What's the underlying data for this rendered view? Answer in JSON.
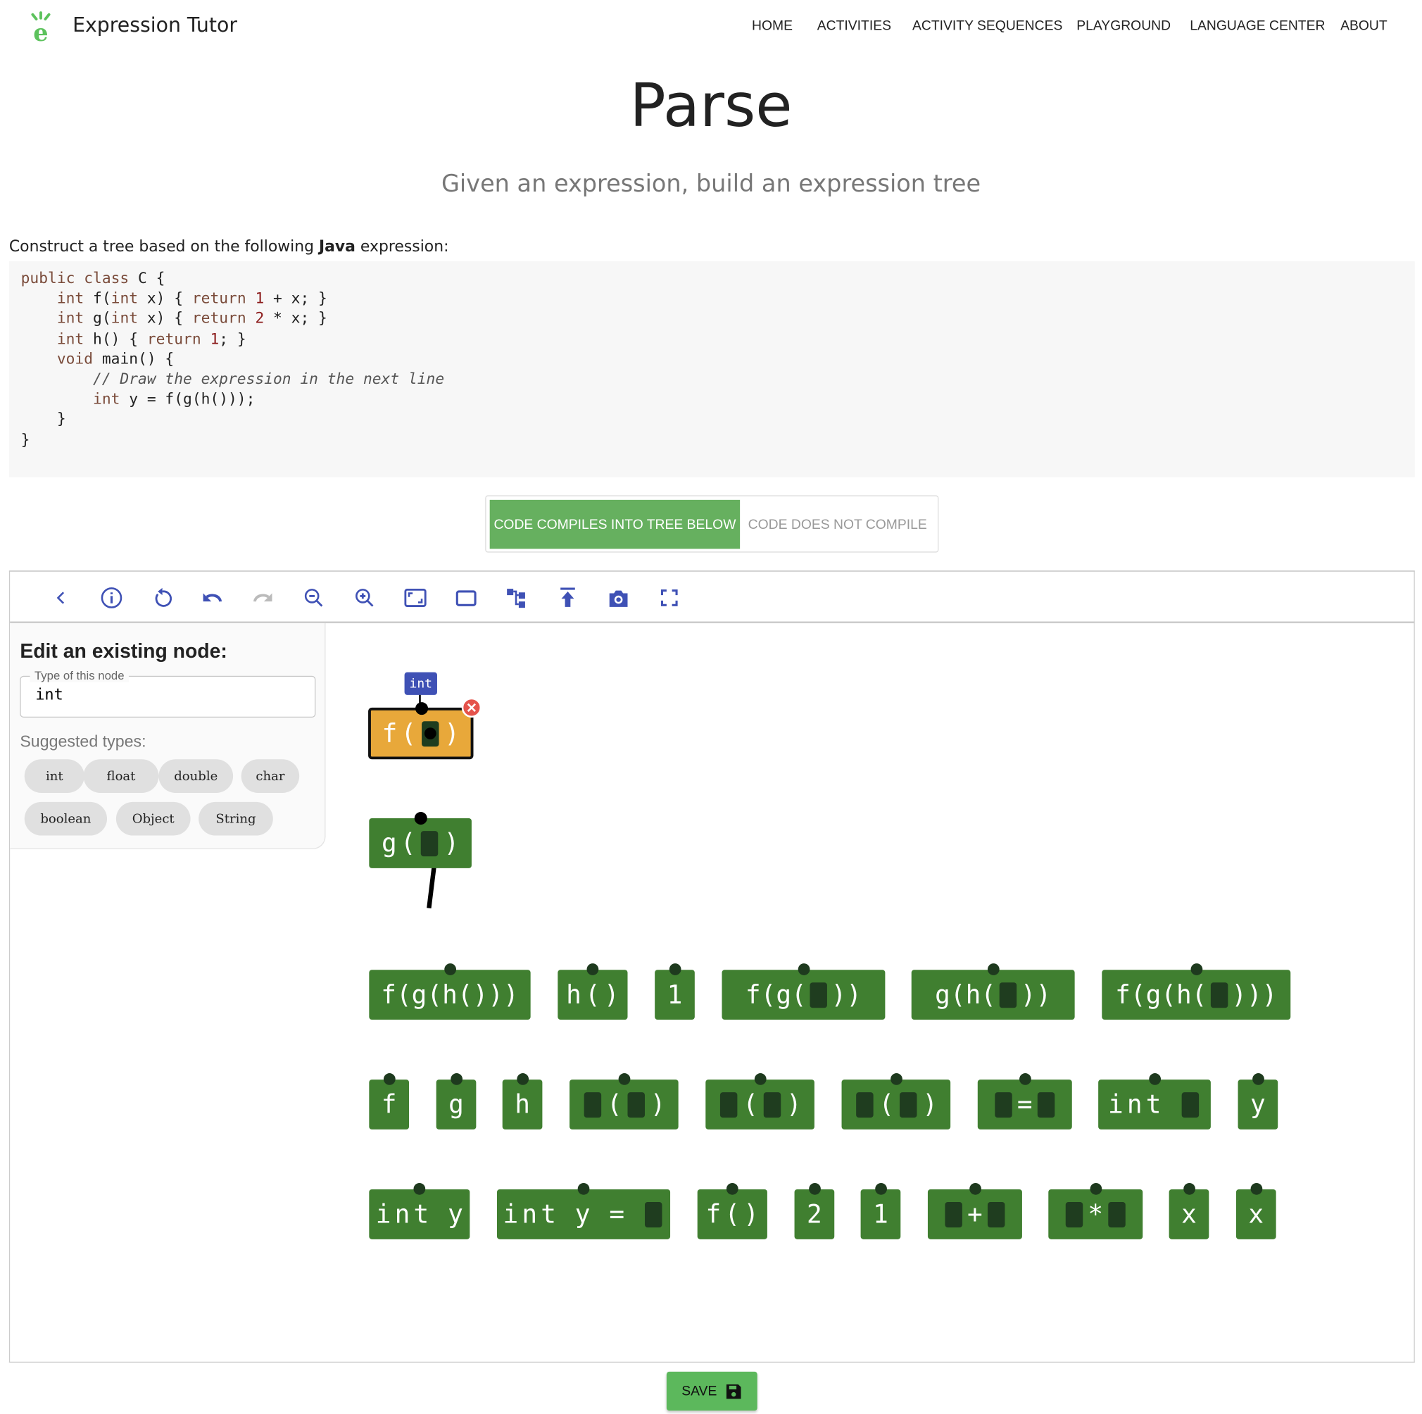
{
  "header": {
    "app_title": "Expression Tutor",
    "nav": [
      "HOME",
      "ACTIVITIES",
      "ACTIVITY SEQUENCES",
      "PLAYGROUND",
      "LANGUAGE CENTER",
      "ABOUT"
    ]
  },
  "page": {
    "title": "Parse",
    "subtitle": "Given an expression, build an expression tree",
    "instruction_prefix": "Construct a tree based on the following ",
    "instruction_lang": "Java",
    "instruction_suffix": " expression:"
  },
  "code": [
    "public class C {",
    "    int f(int x) { return 1 + x; }",
    "    int g(int x) { return 2 * x; }",
    "    int h() { return 1; }",
    "",
    "    void main() {",
    "        // Draw the expression in the next line",
    "        int y = f(g(h()));",
    "    }",
    "}"
  ],
  "choice": {
    "compiles": "CODE COMPILES INTO TREE BELOW",
    "not_compile": "CODE DOES NOT COMPILE"
  },
  "toolbar": [
    "chevron-left",
    "info",
    "reset",
    "undo",
    "redo",
    "zoom-out",
    "zoom-in",
    "fit-screen",
    "rectangle",
    "tree-layout",
    "upload",
    "camera",
    "fullscreen"
  ],
  "edit_panel": {
    "title": "Edit an existing node:",
    "field_label": "Type of this node",
    "field_value": "int",
    "suggested_label": "Suggested types:",
    "types": [
      "int",
      "float",
      "double",
      "char",
      "boolean",
      "Object",
      "String"
    ]
  },
  "tree": {
    "root": {
      "label": "f(■)",
      "type": "int"
    },
    "child": {
      "label": "g(■)"
    }
  },
  "palette": [
    [
      "f(g(h()))",
      "h()",
      "1",
      "f(g(■))",
      "g(h(■))",
      "f(g(h(■)))"
    ],
    [
      "f",
      "g",
      "h",
      "■(■)",
      "■(■)",
      "■(■)",
      "■=■",
      "int ■",
      "y"
    ],
    [
      "int y",
      "int y = ■",
      "f()",
      "2",
      "1",
      "■+■",
      "■*■",
      "x",
      "x"
    ]
  ],
  "colors": {
    "node": "#407f30",
    "selected": "#e8a83a",
    "accent": "#3f51b5",
    "delete": "#e5534b"
  },
  "save_label": "SAVE"
}
